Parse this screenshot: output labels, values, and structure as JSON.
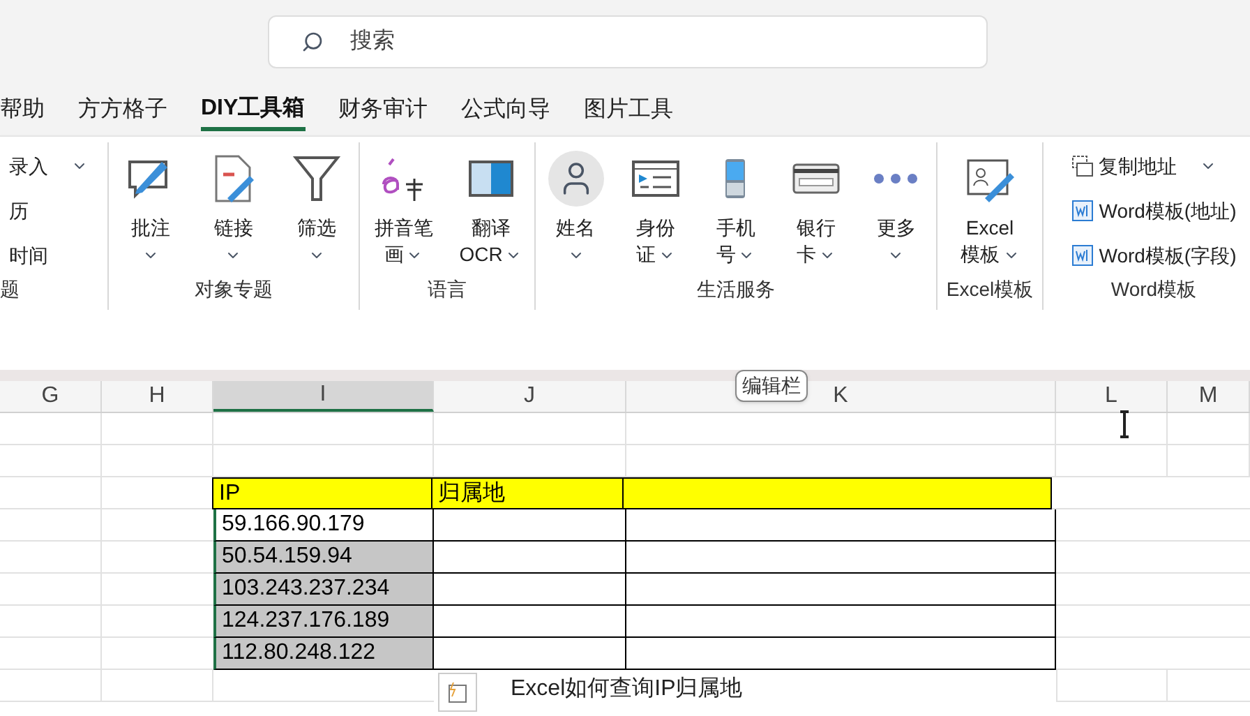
{
  "search": {
    "placeholder": "搜索"
  },
  "tabs": [
    {
      "label": "帮助",
      "selected": false
    },
    {
      "label": "方方格子",
      "selected": false
    },
    {
      "label": "DIY工具箱",
      "selected": true
    },
    {
      "label": "财务审计",
      "selected": false
    },
    {
      "label": "公式向导",
      "selected": false
    },
    {
      "label": "图片工具",
      "selected": false
    }
  ],
  "ribbon": {
    "groups": [
      {
        "label": "题",
        "kind": "list",
        "items": [
          {
            "label": "录入",
            "dropdown": true
          },
          {
            "label": "历",
            "dropdown": false
          },
          {
            "label": "时间",
            "dropdown": false
          }
        ]
      },
      {
        "label": "对象专题",
        "kind": "large",
        "items": [
          {
            "label": "批注",
            "dropdown": true
          },
          {
            "label": "链接",
            "dropdown": true
          },
          {
            "label": "筛选",
            "dropdown": true
          }
        ]
      },
      {
        "label": "语言",
        "kind": "large",
        "items": [
          {
            "label": "拼音笔",
            "label2": "画",
            "dropdown": true
          },
          {
            "label": "翻译",
            "label2": "OCR",
            "dropdown": true
          }
        ]
      },
      {
        "label": "生活服务",
        "kind": "large",
        "items": [
          {
            "label": "姓名",
            "dropdown": true
          },
          {
            "label": "身份",
            "label2": "证",
            "dropdown": true
          },
          {
            "label": "手机",
            "label2": "号",
            "dropdown": true
          },
          {
            "label": "银行",
            "label2": "卡",
            "dropdown": true
          },
          {
            "label": "更多",
            "dropdown": true
          }
        ]
      },
      {
        "label": "Excel模板",
        "kind": "large",
        "items": [
          {
            "label": "Excel",
            "label2": "模板",
            "dropdown": true
          }
        ]
      },
      {
        "label": "Word模板",
        "kind": "list",
        "items": [
          {
            "label": "复制地址",
            "dropdown": true
          },
          {
            "label": "Word模板(地址)",
            "dropdown": false
          },
          {
            "label": "Word模板(字段)",
            "dropdown": false
          }
        ]
      }
    ]
  },
  "tooltip": "编辑栏",
  "sheet": {
    "columns": [
      {
        "label": "G",
        "selected": false
      },
      {
        "label": "H",
        "selected": false
      },
      {
        "label": "I",
        "selected": true
      },
      {
        "label": "J",
        "selected": false
      },
      {
        "label": "K",
        "selected": false
      },
      {
        "label": "L",
        "selected": false
      },
      {
        "label": "M",
        "selected": false
      }
    ],
    "table": {
      "header": [
        "IP",
        "归属地"
      ],
      "rows": [
        {
          "ip": "59.166.90.179",
          "selected": false
        },
        {
          "ip": "50.54.159.94",
          "selected": true
        },
        {
          "ip": "103.243.237.234",
          "selected": true
        },
        {
          "ip": "124.237.176.189",
          "selected": true
        },
        {
          "ip": "112.80.248.122",
          "selected": true
        }
      ]
    },
    "caption": "Excel如何查询IP归属地"
  }
}
